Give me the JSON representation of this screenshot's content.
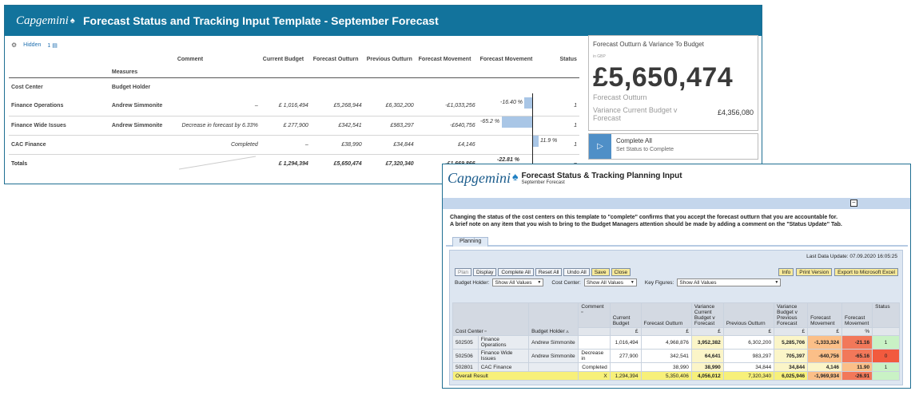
{
  "win1": {
    "logo": "Capgemini",
    "title": "Forecast Status and Tracking Input Template - September Forecast",
    "controls": {
      "hidden_label": "Hidden",
      "count_label": "1"
    },
    "headers": {
      "measures": "Measures",
      "comment": "Comment",
      "current_budget": "Current Budget",
      "forecast_outturn": "Forecast Outturn",
      "previous_outturn": "Previous Outturn",
      "forecast_movement": "Forecast Movement",
      "forecast_movement_chart": "Forecast Movement",
      "status": "Status",
      "cost_center": "Cost Center",
      "budget_holder": "Budget Holder"
    },
    "rows": [
      {
        "cost_center": "Finance Operations",
        "holder": "Andrew Simmonite",
        "comment": "–",
        "budget": "£ 1,016,494",
        "outturn": "£5,268,944",
        "previous": "£6,302,200",
        "movement": "-£1,033,256",
        "pct": "-16.40 %",
        "pct_value": -16.4,
        "status": "1"
      },
      {
        "cost_center": "Finance Wide Issues",
        "holder": "Andrew Simmonite",
        "comment": "Decrease in forecast by 6.33%",
        "budget": "£ 277,900",
        "outturn": "£342,541",
        "previous": "£983,297",
        "movement": "-£640,756",
        "pct": "-65.2 %",
        "pct_value": -65.2,
        "status": "1"
      },
      {
        "cost_center": "CAC Finance",
        "holder": "",
        "comment": "Completed",
        "budget": "–",
        "outturn": "£38,990",
        "previous": "£34,844",
        "movement": "£4,146",
        "pct": "11.9 %",
        "pct_value": 11.9,
        "status": "1"
      }
    ],
    "totals": {
      "label": "Totals",
      "budget": "£ 1,294,394",
      "outturn": "£5,650,474",
      "previous": "£7,320,340",
      "movement": "-£1,669,866",
      "pct": "-22.81 %",
      "pct_value": -22.81,
      "status": "–"
    },
    "kpi": {
      "title": "Forecast Outturn & Variance To Budget",
      "sub": "in GBP",
      "value": "£5,650,474",
      "label": "Forecast Outturn",
      "var_label": "Variance Current Budget v Forecast",
      "var_value": "£4,356,080"
    },
    "complete": {
      "title": "Complete All",
      "sub": "Set Status to Complete"
    }
  },
  "win2": {
    "logo": "Capgemini",
    "title": "Forecast Status & Tracking Planning Input",
    "subtitle": "September Forecast",
    "notice_1": "Changing the status of the cost centers on this template to \"complete\" confirms that you accept the forecast outturn that you are accountable for.",
    "notice_2": "A brief note on any item that you wish to bring to the Budget Managers attention should be made by adding a comment on the \"Status Update\" Tab.",
    "tab": "Planning",
    "last_update": "Last Data Update: 07.09.2020 16:05:25",
    "buttons": [
      "Plan",
      "Display",
      "Complete All",
      "Reset All",
      "Undo All",
      "Save",
      "Close"
    ],
    "buttons_right": [
      "Info",
      "Print Version",
      "Export to Microsoft Excel"
    ],
    "filters": {
      "budget_holder_label": "Budget Holder:",
      "budget_holder_value": "Show All Values",
      "cost_center_label": "Cost Center:",
      "cost_center_value": "Show All Values",
      "key_figures_label": "Key Figures:",
      "key_figures_value": "Show All Values"
    },
    "headers": {
      "comment": "Comment",
      "current_budget": "Current Budget",
      "forecast_outturn": "Forecast Outturn",
      "variance_cb": "Variance Current Budget v Forecast",
      "previous_outturn": "Previous Outturn",
      "variance_pf": "Variance Budget v Previous Forecast",
      "forecast_movement": "Forecast Movement",
      "forecast_movement_pct": "Forecast Movement",
      "status": "Status",
      "cost_center": "Cost Center",
      "budget_holder": "Budget Holder"
    },
    "units": {
      "gbp": "£",
      "pct": "%"
    },
    "rows": [
      {
        "id": "502505",
        "name": "Finance Operations",
        "holder": "Andrew Simmonite",
        "comment": "",
        "budget": "1,016,494",
        "outturn": "4,968,876",
        "var_cb": "3,952,382",
        "previous": "6,302,200",
        "var_pf": "5,285,706",
        "movement": "-1,333,324",
        "pct": "-21.16",
        "status": "1"
      },
      {
        "id": "502506",
        "name": "Finance Wide Issues",
        "holder": "Andrew Simmonite",
        "comment": "Decrease in",
        "budget": "277,900",
        "outturn": "342,541",
        "var_cb": "64,641",
        "previous": "983,297",
        "var_pf": "705,397",
        "movement": "-640,756",
        "pct": "-65.16",
        "status": "0"
      },
      {
        "id": "502801",
        "name": "CAC Finance",
        "holder": "",
        "comment": "Completed",
        "budget": "",
        "outturn": "38,990",
        "var_cb": "38,990",
        "previous": "34,844",
        "var_pf": "34,844",
        "movement": "4,146",
        "pct": "11.90",
        "status": "1"
      }
    ],
    "overall": {
      "label": "Overall Result",
      "comment": "X",
      "budget": "1,294,394",
      "outturn": "5,350,406",
      "var_cb": "4,056,012",
      "previous": "7,320,340",
      "var_pf": "6,025,946",
      "movement": "-1,969,934",
      "pct": "-26.91",
      "status": ""
    }
  }
}
